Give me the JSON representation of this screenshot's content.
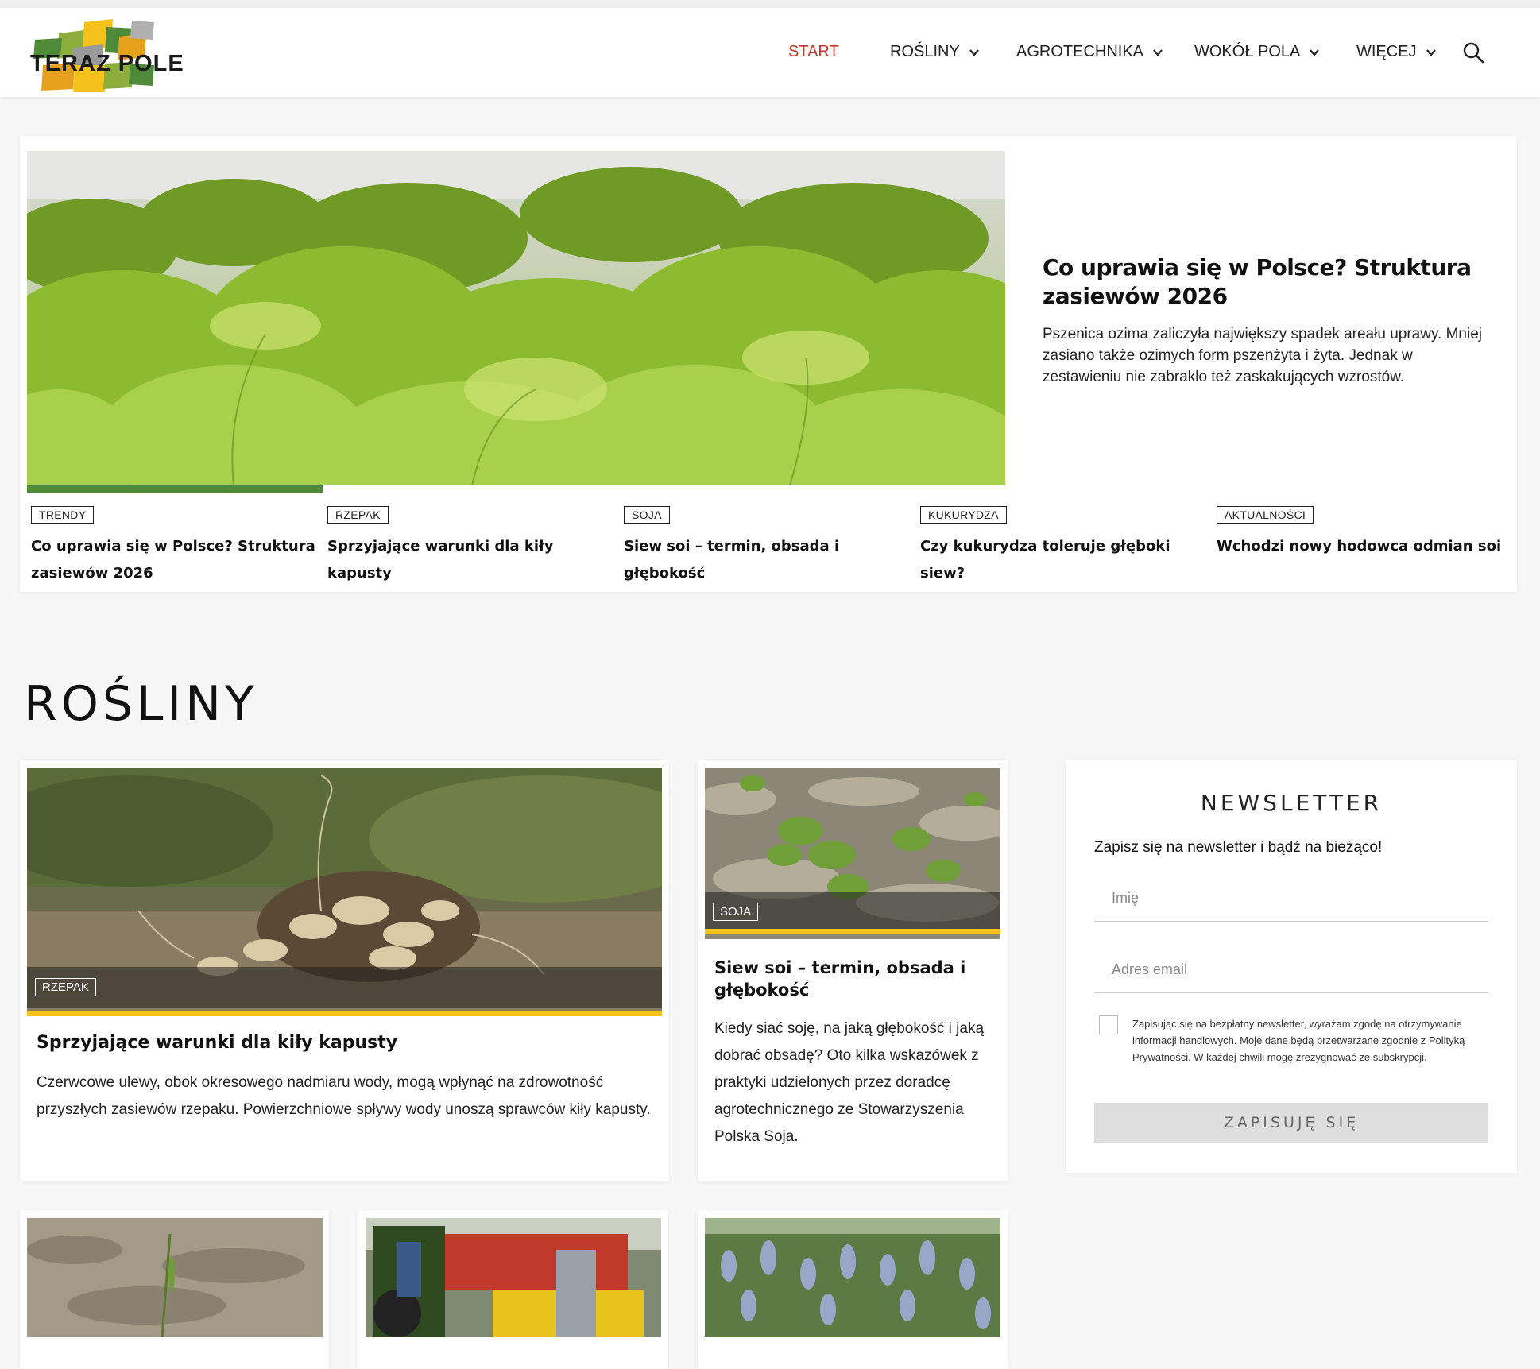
{
  "brand": {
    "logo_text": "TERAZ POLE",
    "logo_colors": [
      "#f4c21b",
      "#4f8a3a",
      "#8cae3c",
      "#9a9a9a",
      "#e5a11c"
    ]
  },
  "nav": {
    "items": [
      {
        "label": "START",
        "active": true
      },
      {
        "label": "ROŚLINY",
        "dropdown": true
      },
      {
        "label": "AGROTECHNIKA",
        "dropdown": true
      },
      {
        "label": "WOKÓŁ POLA",
        "dropdown": true
      },
      {
        "label": "WIĘCEJ",
        "dropdown": true
      }
    ],
    "search_icon": "search-icon",
    "active_color": "#c0392b"
  },
  "hero": {
    "title": "Co uprawia się w Polsce? Struktura zasiewów 2026",
    "description": "Pszenica ozima zaliczyła największy spadek areału uprawy. Mniej zasiano także ozimych form pszenżyta i żyta. Jednak w zestawieniu nie zabrakło też zaskakujących wzrostów.",
    "tabs": [
      {
        "tag": "TRENDY",
        "title": "Co uprawia się w Polsce? Struktura zasiewów 2026"
      },
      {
        "tag": "RZEPAK",
        "title": "Sprzyjające warunki dla kiły kapusty"
      },
      {
        "tag": "SOJA",
        "title": "Siew soi – termin, obsada i głębokość"
      },
      {
        "tag": "KUKURYDZA",
        "title": "Czy kukurydza toleruje głęboki siew?"
      },
      {
        "tag": "AKTUALNOŚCI",
        "title": "Wchodzi nowy hodowca odmian soi"
      }
    ]
  },
  "section": {
    "title": "ROŚLINY",
    "cards": [
      {
        "tag": "RZEPAK",
        "title": "Sprzyjające warunki dla kiły kapusty",
        "description": "Czerwcowe ulewy, obok okresowego nadmiaru wody, mogą wpłynąć na zdrowotność przyszłych zasiewów rzepaku. Powierzchniowe spływy wody unoszą sprawców kiły kapusty."
      },
      {
        "tag": "SOJA",
        "title": "Siew soi – termin, obsada i głębokość",
        "description": "Kiedy siać soję, na jaką głębokość i jaką dobrać obsadę? Oto kilka wskazówek z praktyki udzielonych przez doradcę agrotechnicznego ze Stowarzyszenia Polska Soja."
      }
    ]
  },
  "newsletter": {
    "title": "NEWSLETTER",
    "subtitle": "Zapisz się na newsletter i bądź na bieżąco!",
    "name_placeholder": "Imię",
    "email_placeholder": "Adres email",
    "consent": "Zapisując się na bezpłatny newsletter, wyrażam zgodę na otrzymywanie informacji handlowych. Moje dane będą przetwarzane zgodnie z Polityką Prywatności. W każdej chwili mogę zrezygnować ze subskrypcji.",
    "button": "ZAPISUJĘ SIĘ"
  }
}
